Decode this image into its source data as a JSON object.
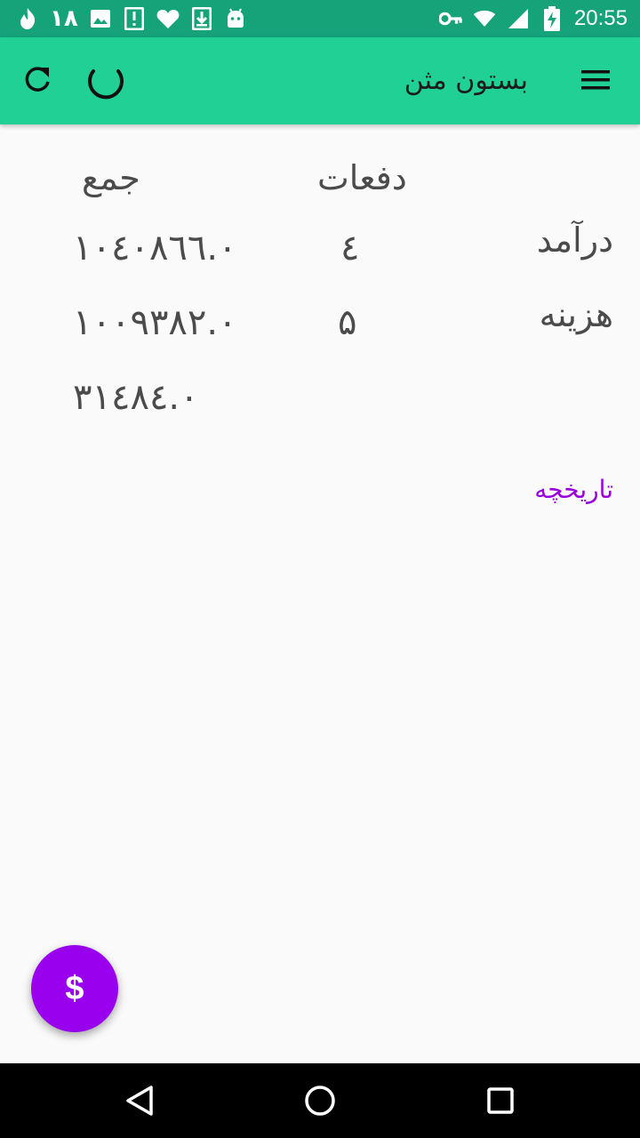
{
  "status_bar": {
    "notification_count": "۱۸",
    "time": "20:55",
    "icons_left": [
      "fire-icon",
      "image-icon",
      "alert-icon",
      "heart-icon",
      "download-icon",
      "android-icon"
    ],
    "icons_right": [
      "key-icon",
      "wifi-icon",
      "signal-icon",
      "battery-charging-icon"
    ]
  },
  "app_bar": {
    "title": "بستون مثن",
    "icons": [
      "menu-icon",
      "refresh-icon",
      "loading-spinner-icon"
    ]
  },
  "summary": {
    "headers": {
      "count": "دفعات",
      "total": "جمع"
    },
    "rows": [
      {
        "label": "درآمد",
        "count": "٤",
        "total": "۱۰٤۰۸٦٦.۰"
      },
      {
        "label": "هزینه",
        "count": "۵",
        "total": "۱۰۰۹۳۸۲.۰"
      }
    ],
    "balance": "۳۱٤۸٤.۰"
  },
  "history_link": "تاریخچه",
  "fab": {
    "label": "$"
  },
  "nav_bar": {
    "icons": [
      "back-icon",
      "home-icon",
      "recents-icon"
    ]
  },
  "colors": {
    "status_bar": "#16a37a",
    "app_bar": "#20d095",
    "accent": "#9900ee",
    "link": "#9900dd",
    "text": "#4b4b4b"
  }
}
